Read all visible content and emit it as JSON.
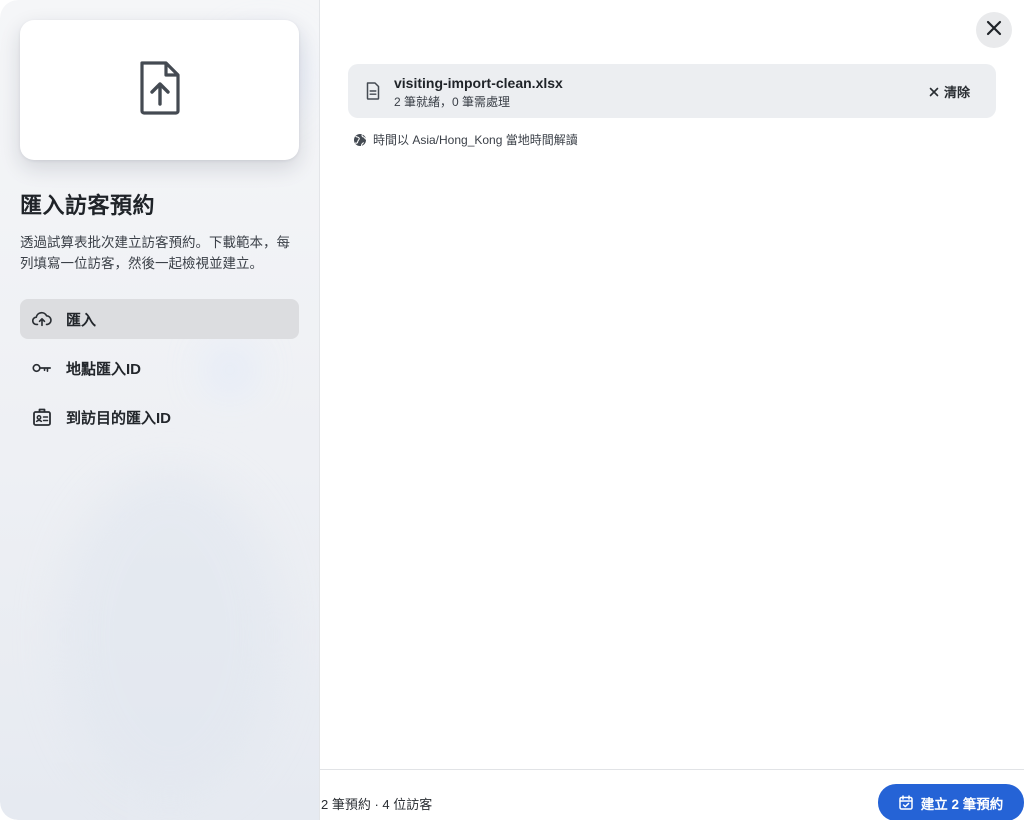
{
  "dialog": {
    "title": "匯入訪客預約",
    "description": "透過試算表批次建立訪客預約。下載範本，每列填寫一位訪客，然後一起檢視並建立。"
  },
  "nav": {
    "items": [
      {
        "label": "匯入",
        "icon": "cloud-upload-icon",
        "active": true
      },
      {
        "label": "地點匯入ID",
        "icon": "key-icon",
        "active": false
      },
      {
        "label": "到訪目的匯入ID",
        "icon": "id-badge-icon",
        "active": false
      }
    ]
  },
  "file": {
    "name": "visiting-import-clean.xlsx",
    "status": "2 筆就緒，0 筆需處理",
    "clear_label": "清除"
  },
  "timezone_note": "時間以 Asia/Hong_Kong 當地時間解讀",
  "footer": {
    "summary": "2 筆預約 · 4 位訪客",
    "create_label": "建立 2 筆預約"
  },
  "colors": {
    "primary": "#2563d6",
    "active_nav_bg": "#dcdde0",
    "file_card_bg": "#eceef1"
  }
}
